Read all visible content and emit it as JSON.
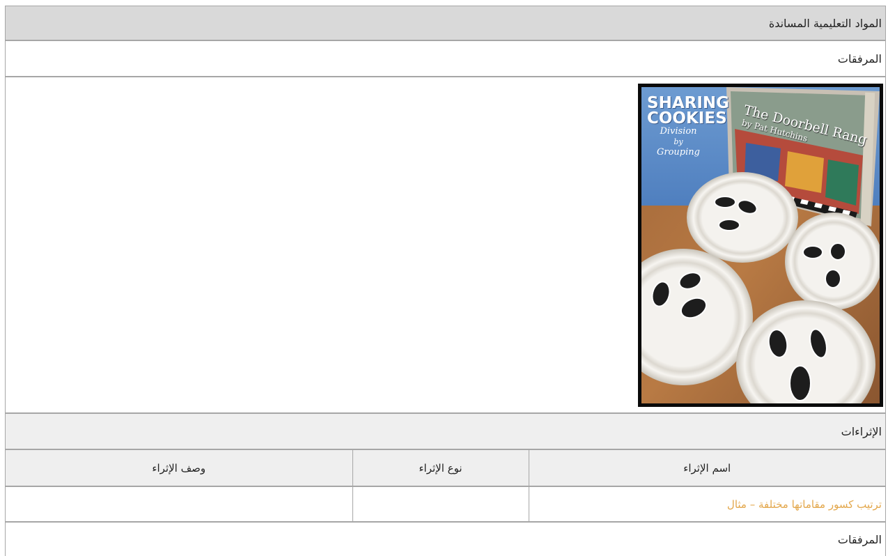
{
  "header": {
    "title": "المواد التعليمية المساندة"
  },
  "attachments_1": {
    "label": "المرفقات"
  },
  "media": {
    "image_title_line1": "SHARING",
    "image_title_line2": "COOKIES",
    "image_sub_line1": "Division",
    "image_sub_line2": "by",
    "image_sub_line3": "Grouping",
    "book_title": "The Doorbell Rang",
    "book_author": "by Pat Hutchins"
  },
  "enrichments": {
    "label": "الإثراءات",
    "columns": [
      "اسم الإثراء",
      "نوع الإثراء",
      "وصف الإثراء"
    ],
    "rows": [
      {
        "name": "ترتيب كسور مقاماتها مختلفة – مثال",
        "type": "",
        "description": ""
      }
    ]
  },
  "attachments_2": {
    "label": "المرفقات"
  },
  "colors": {
    "header_bg": "#d9d9d9",
    "row_bg": "#efefef",
    "link": "#e3a74b",
    "border": "#a6a6a6"
  }
}
